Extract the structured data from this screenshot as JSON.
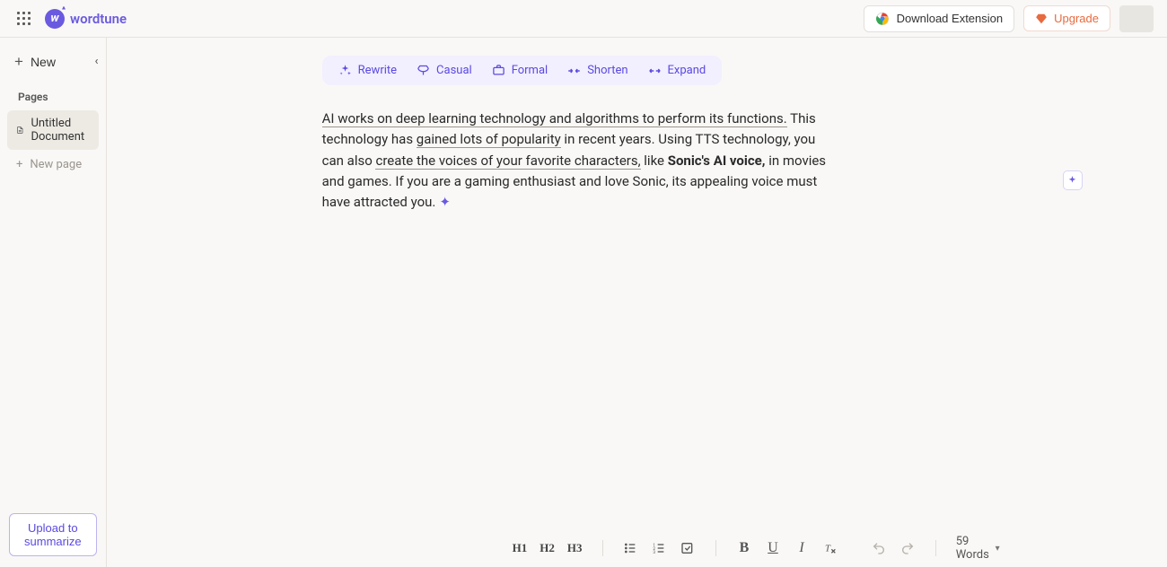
{
  "header": {
    "brand": "wordtune",
    "download_label": "Download Extension",
    "upgrade_label": "Upgrade"
  },
  "sidebar": {
    "new_label": "New",
    "pages_label": "Pages",
    "items": [
      {
        "label": "Untitled Document",
        "active": true
      }
    ],
    "new_page_label": "New page",
    "upload_label": "Upload to summarize"
  },
  "toolbar": {
    "rewrite": "Rewrite",
    "casual": "Casual",
    "formal": "Formal",
    "shorten": "Shorten",
    "expand": "Expand"
  },
  "document": {
    "seg1": "AI works on deep learning technology and algorithms to perform its functions.",
    "seg2": " This technology has ",
    "seg3": "gained lots of popularity",
    "seg4": " in recent years. Using TTS technology, you can also ",
    "seg5": "create the voices of your favorite characters,",
    "seg6": " like ",
    "seg7": "Sonic's AI voice,",
    "seg8": " in movies and games. If you are a gaming enthusiast and love Sonic, its appealing voice must have attracted you."
  },
  "bottom": {
    "h1": "H1",
    "h2": "H2",
    "h3": "H3",
    "word_count": "59 Words"
  }
}
